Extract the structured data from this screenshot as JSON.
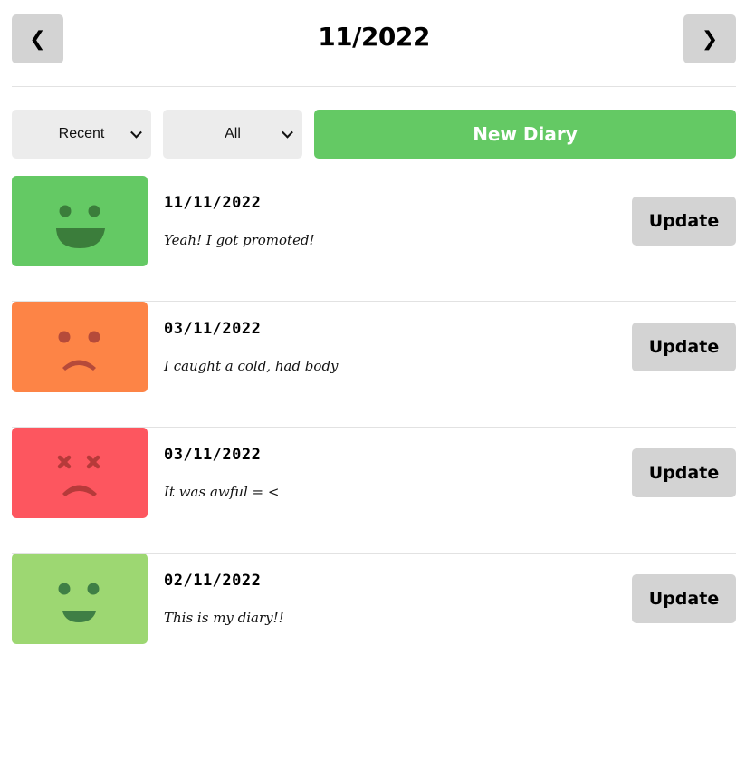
{
  "header": {
    "prev_label": "❮",
    "title": "11/2022",
    "next_label": "❯"
  },
  "controls": {
    "sort_selected": "Recent",
    "filter_selected": "All",
    "new_button_label": "New Diary",
    "new_button_color": "#64C964"
  },
  "diaries": [
    {
      "date": "11/11/2022",
      "content": "Yeah! I got promoted!",
      "emotion": "very-happy-face-icon",
      "color": "#64C964",
      "update_label": "Update"
    },
    {
      "date": "03/11/2022",
      "content": "I caught a cold, had body",
      "emotion": "sad-face-icon",
      "color": "#FD8446",
      "update_label": "Update"
    },
    {
      "date": "03/11/2022",
      "content": "It was awful = <",
      "emotion": "terrible-face-icon",
      "color": "#FD565F",
      "update_label": "Update"
    },
    {
      "date": "02/11/2022",
      "content": "This is my diary!!",
      "emotion": "happy-face-icon",
      "color": "#9DD772",
      "update_label": "Update"
    }
  ]
}
